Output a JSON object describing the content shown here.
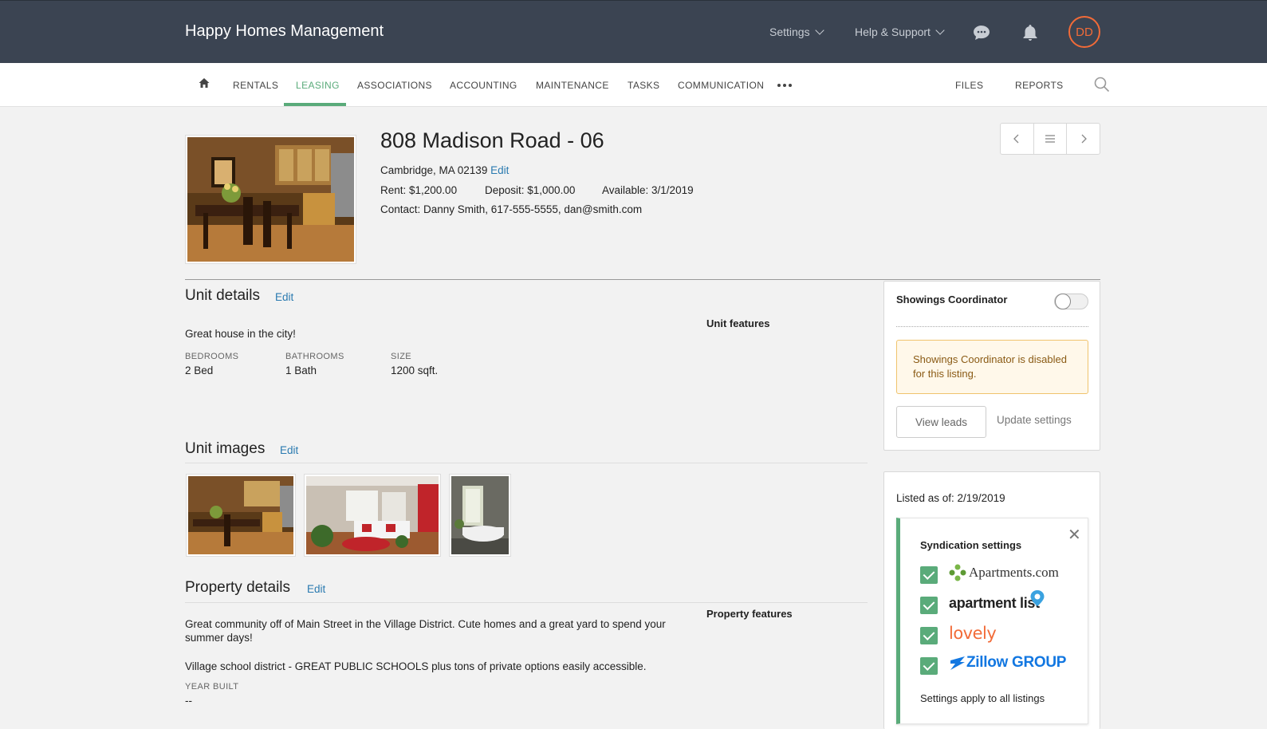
{
  "header": {
    "brand": "Happy Homes Management",
    "settings_label": "Settings",
    "help_label": "Help & Support",
    "avatar_initials": "DD"
  },
  "nav": {
    "items": [
      "RENTALS",
      "LEASING",
      "ASSOCIATIONS",
      "ACCOUNTING",
      "MAINTENANCE",
      "TASKS",
      "COMMUNICATION"
    ],
    "active": "LEASING",
    "files": "FILES",
    "reports": "REPORTS"
  },
  "listing": {
    "title": "808 Madison Road - 06",
    "address": "Cambridge, MA 02139",
    "edit": "Edit",
    "rent": "Rent: $1,200.00",
    "deposit": "Deposit: $1,000.00",
    "available": "Available: 3/1/2019",
    "contact": "Contact: Danny Smith, 617-555-5555, dan@smith.com"
  },
  "unit_details": {
    "title": "Unit details",
    "edit": "Edit",
    "description": "Great house in the city!",
    "bedrooms_label": "BEDROOMS",
    "bedrooms_value": "2 Bed",
    "bathrooms_label": "BATHROOMS",
    "bathrooms_value": "1 Bath",
    "size_label": "SIZE",
    "size_value": "1200 sqft.",
    "features_title": "Unit features"
  },
  "unit_images": {
    "title": "Unit images",
    "edit": "Edit"
  },
  "property_details": {
    "title": "Property details",
    "edit": "Edit",
    "description1": "Great community off of Main Street in the Village District. Cute homes and a great yard to spend your summer days!",
    "description2": "Village school district - GREAT PUBLIC SCHOOLS plus tons of private options easily accessible.",
    "year_built_label": "YEAR BUILT",
    "year_built_value": "--",
    "features_title": "Property features"
  },
  "showings": {
    "title": "Showings Coordinator",
    "enabled": false,
    "alert": "Showings Coordinator is disabled for this listing.",
    "view_leads": "View leads",
    "update_settings": "Update settings"
  },
  "syndication": {
    "listed_as_of": "Listed as of: 2/19/2019",
    "title": "Syndication settings",
    "partners": [
      {
        "name": "Apartments.com",
        "checked": true
      },
      {
        "name": "apartment list",
        "checked": true
      },
      {
        "name": "lovely",
        "checked": true
      },
      {
        "name": "Zillow GROUP",
        "checked": true
      }
    ],
    "footer": "Settings apply to all listings"
  },
  "colors": {
    "topbar": "#3b4452",
    "accent_green": "#5aab7a",
    "link_blue": "#2a7ab0",
    "avatar_orange": "#f26b38"
  }
}
